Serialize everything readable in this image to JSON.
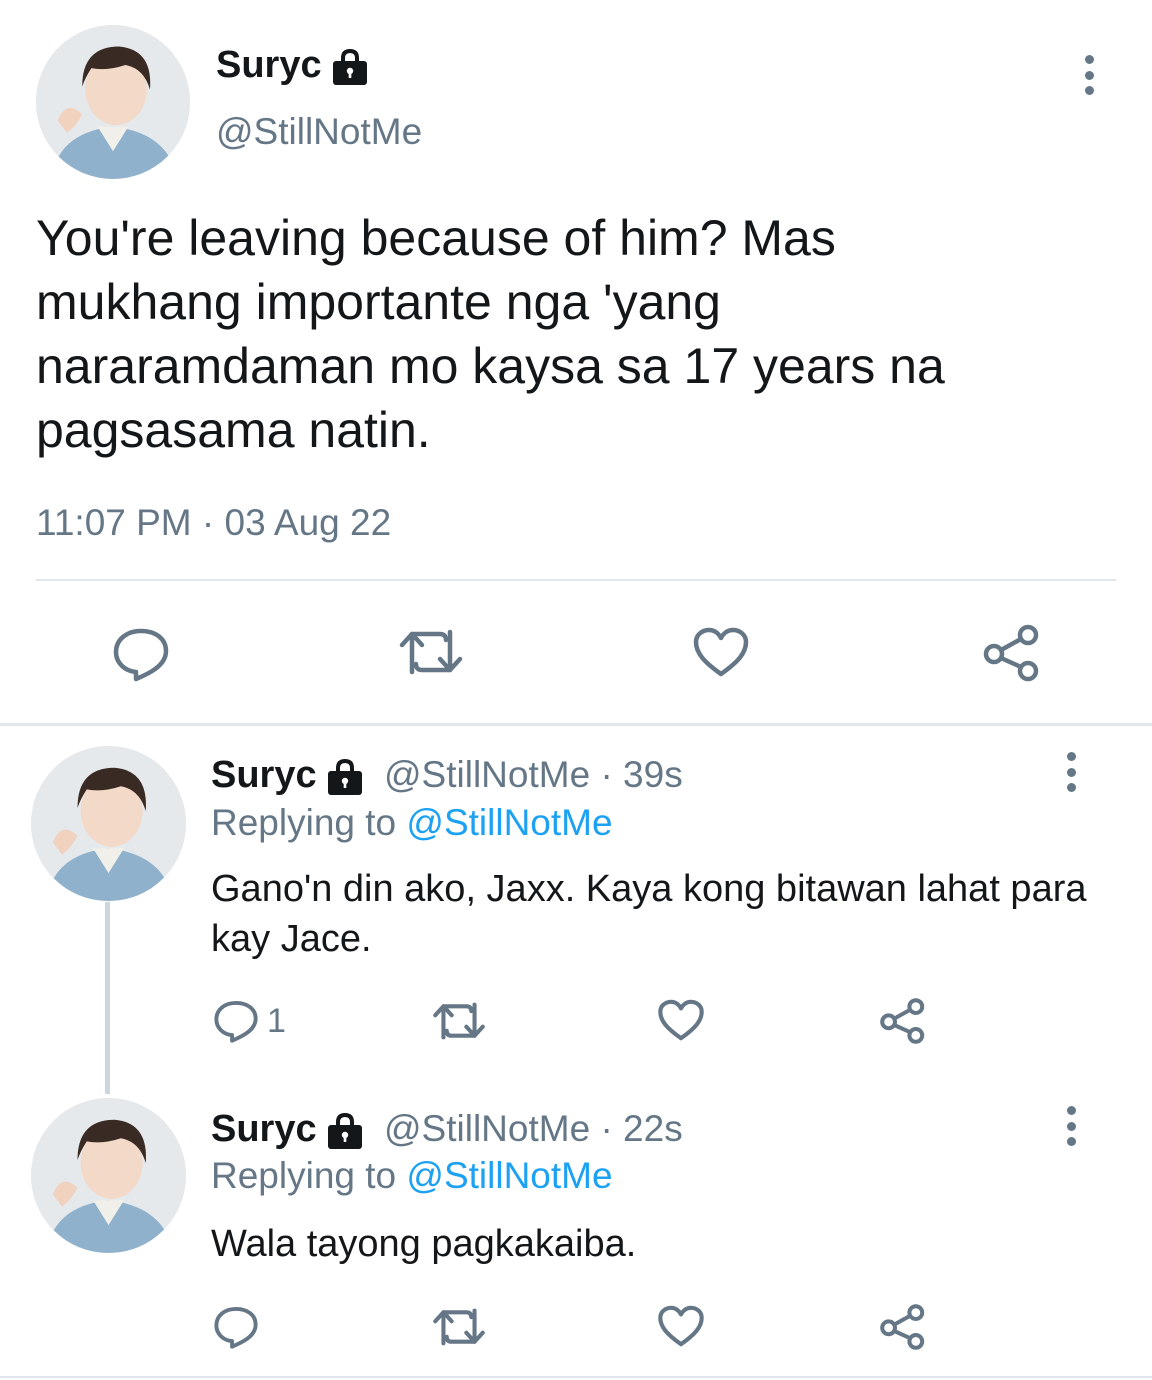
{
  "main_tweet": {
    "display_name": "Suryc",
    "handle": "@StillNotMe",
    "text": "You're leaving because of him? Mas mukhang importante nga 'yang nararamdaman mo kaysa sa 17 years na pagsasama natin.",
    "timestamp": "11:07 PM · 03 Aug 22"
  },
  "replies": [
    {
      "display_name": "Suryc",
      "handle": "@StillNotMe",
      "time": "· 39s",
      "replying_prefix": "Replying to",
      "replying_to": "@StillNotMe",
      "text": "Gano'n din ako, Jaxx. Kaya kong bitawan lahat para kay Jace.",
      "reply_count": "1"
    },
    {
      "display_name": "Suryc",
      "handle": "@StillNotMe",
      "time": "· 22s",
      "replying_prefix": "Replying to",
      "replying_to": "@StillNotMe",
      "text": "Wala tayong pagkakaiba."
    }
  ],
  "colors": {
    "accent": "#1da1f2",
    "muted": "#657786",
    "text": "#14171a",
    "divider": "#e1e8ed"
  },
  "icons": [
    "lock-icon",
    "more-icon",
    "reply-icon",
    "retweet-icon",
    "like-icon",
    "share-icon"
  ]
}
